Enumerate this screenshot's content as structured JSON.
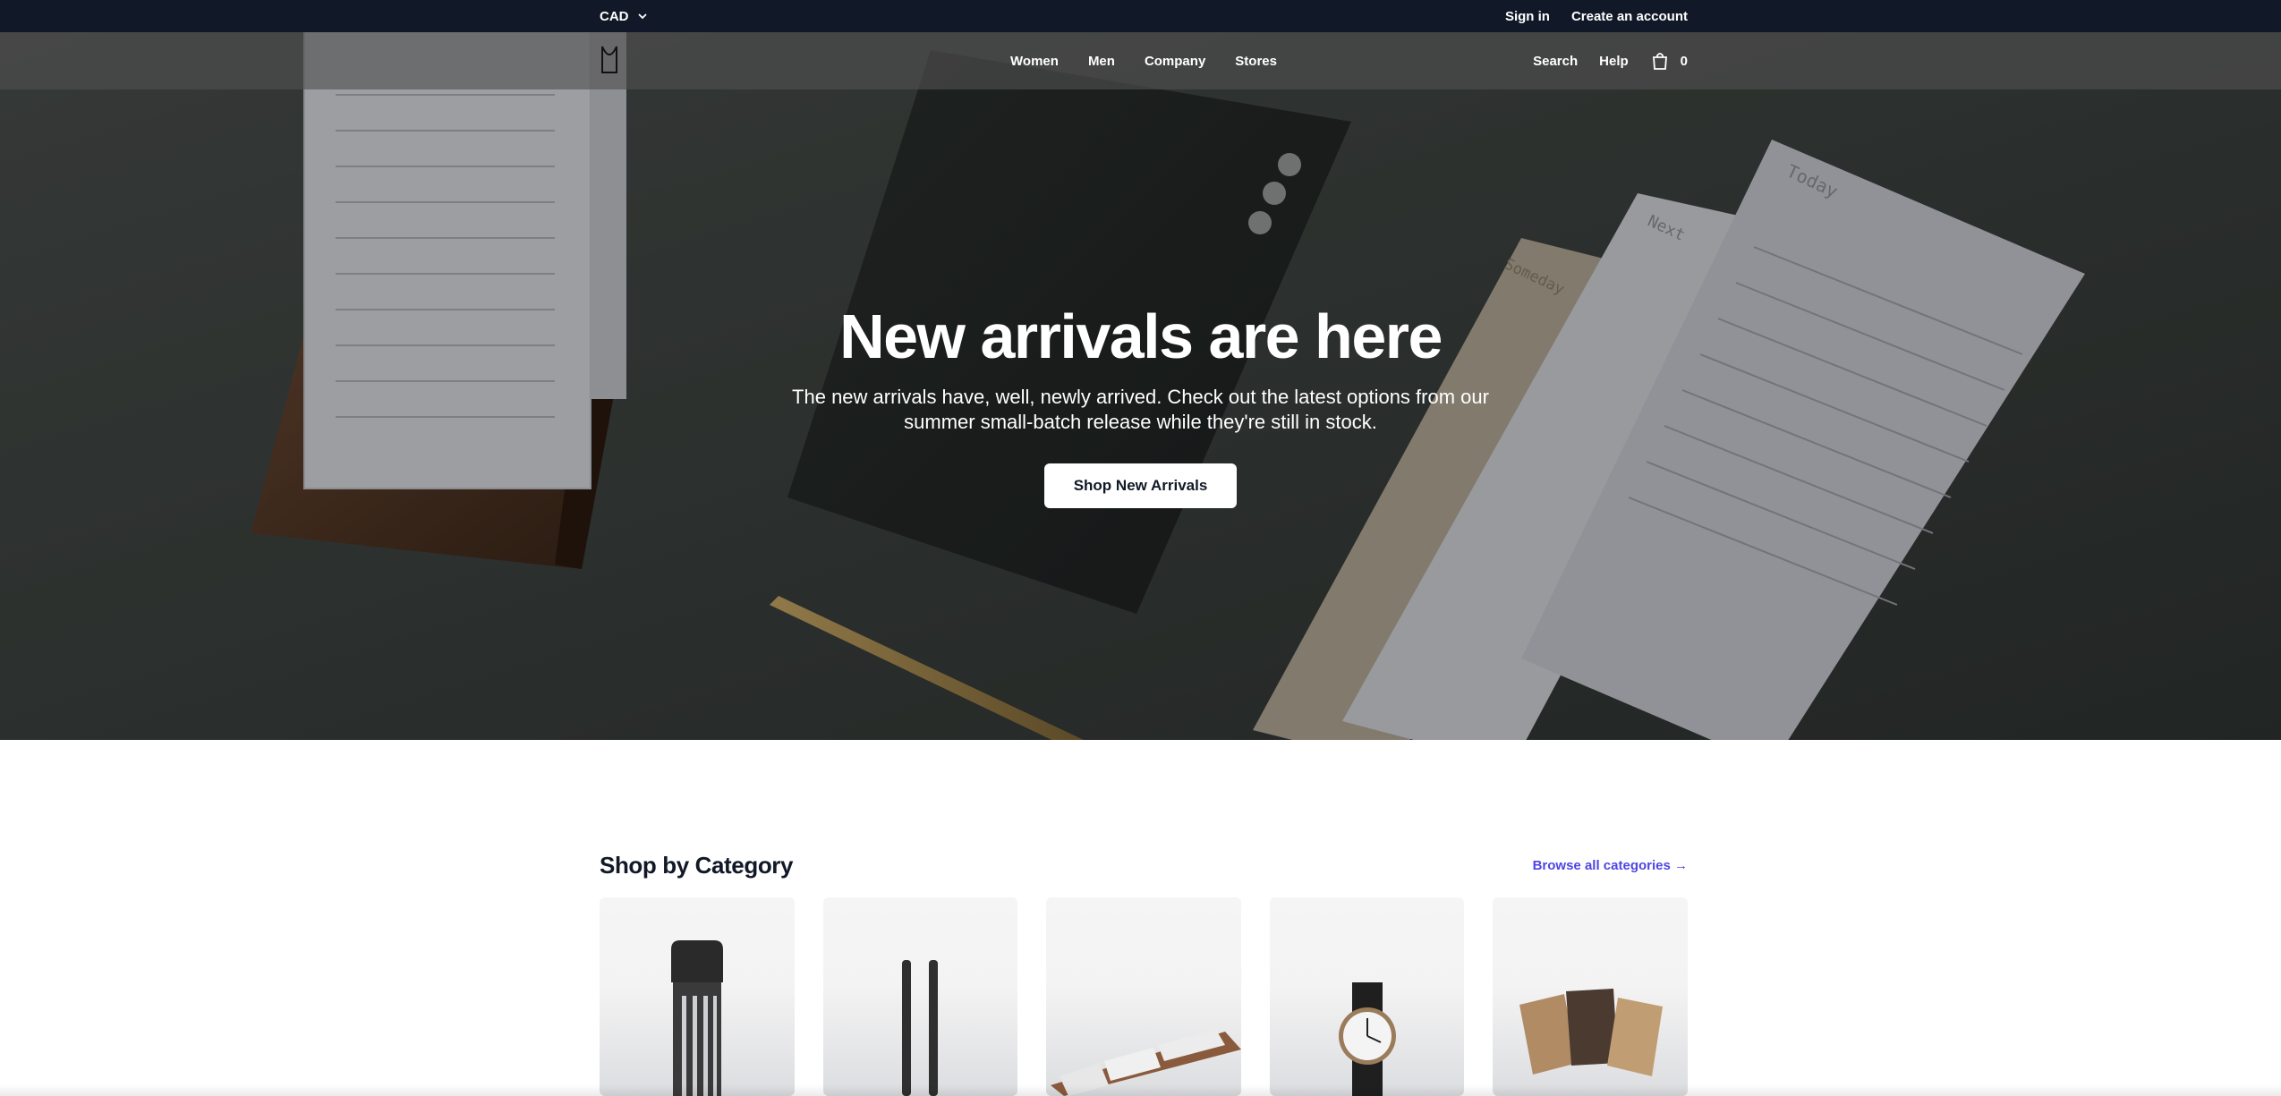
{
  "topbar": {
    "currency": "CAD",
    "sign_in": "Sign in",
    "create_account": "Create an account"
  },
  "nav": {
    "links": [
      "Women",
      "Men",
      "Company",
      "Stores"
    ],
    "search": "Search",
    "help": "Help",
    "cart_count": "0"
  },
  "hero": {
    "title": "New arrivals are here",
    "subtitle": "The new arrivals have, well, newly arrived. Check out the latest options from our summer small-batch release while they're still in stock.",
    "button": "Shop New Arrivals",
    "card_labels": [
      "Today",
      "Next",
      "Someday"
    ]
  },
  "categories": {
    "title": "Shop by Category",
    "browse_link": "Browse all categories →",
    "items": [
      {
        "icon": "bottle-icon"
      },
      {
        "icon": "pens-icon"
      },
      {
        "icon": "desk-organizer-icon"
      },
      {
        "icon": "watch-icon"
      },
      {
        "icon": "notebooks-icon"
      }
    ]
  },
  "colors": {
    "topbar_bg": "#111827",
    "accent_link": "#4f46e5"
  }
}
